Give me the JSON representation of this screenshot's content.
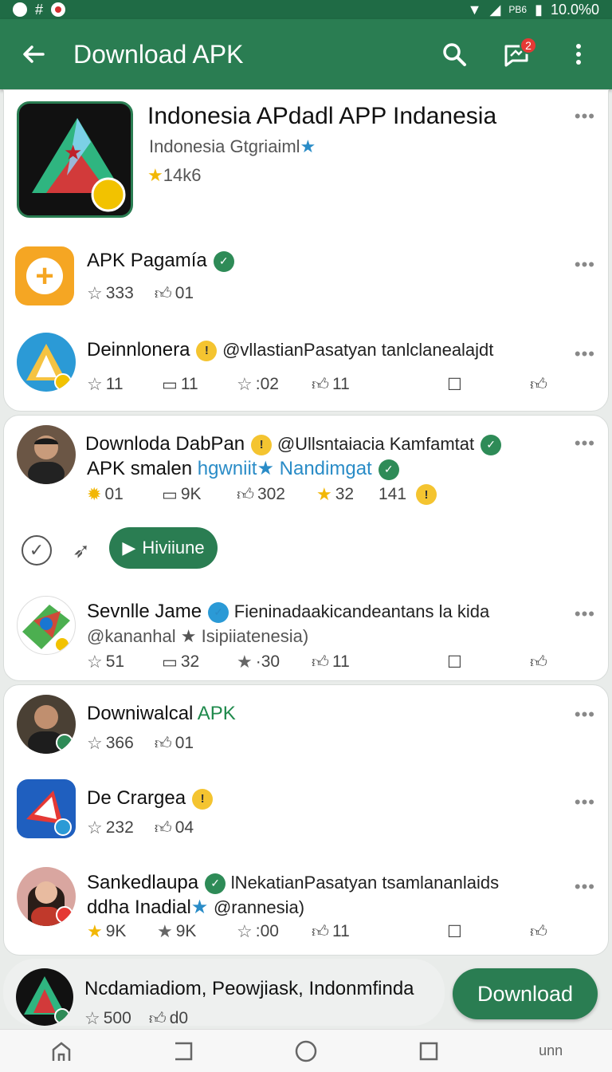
{
  "status_bar": {
    "right_text": "10.0%0",
    "signal_text": "PB6"
  },
  "app_bar": {
    "title": "Download APK",
    "notification_count": "2"
  },
  "featured": {
    "title": "Indonesia APdadl APP Indanesia",
    "developer": "Indonesia Gtgriaiml",
    "rating": "14k6"
  },
  "items_card1": [
    {
      "name": "APK Pagamía",
      "stats": [
        "333",
        "01"
      ]
    },
    {
      "name": "Deinnlonera",
      "handle": "@vllastianPasatyan tanlclanealajdt",
      "stats": [
        "11",
        "11",
        ":02",
        "11"
      ]
    }
  ],
  "items_card2": [
    {
      "name": "Downloda DabPan",
      "handle": "@Ullsntaiacia Kamfamtat",
      "line2_a": "APK smalen",
      "line2_b": "hgwniit",
      "line2_c": "Nandimgat",
      "stats": [
        "01",
        "9K",
        "302",
        "32",
        "141"
      ]
    },
    {
      "name": "Sevnlle Jame",
      "handle": "Fieninadaakicandeantans la kida",
      "line2": "@kananhal",
      "line2_b": "Isipiiatenesia)",
      "stats": [
        "51",
        "32",
        "·30",
        "11"
      ]
    }
  ],
  "action_pill": {
    "label": "Hiviiune"
  },
  "items_card3": [
    {
      "name": "Downiwalcal",
      "name_accent": "APK",
      "stats": [
        "366",
        "01"
      ]
    },
    {
      "name": "De Crargea",
      "stats": [
        "232",
        "04"
      ]
    },
    {
      "name": "Sankedlaupa",
      "handle": "lNekatianPasatyan tsamlananlaids",
      "line2": "ddha Inadial",
      "line2_b": "@rannesia)",
      "stats": [
        "9K",
        "9K",
        ":00",
        "11"
      ]
    }
  ],
  "bottom_item": {
    "name": "Ncdamiadiom, Peowjiask, Indonmfinda",
    "stats": [
      "500",
      "d0"
    ]
  },
  "download_button": {
    "label": "Download"
  },
  "nav": {
    "last_label": "unn"
  },
  "colors": {
    "primary": "#2a7d52",
    "status": "#1f6b45",
    "accent_green": "#1f8a4c",
    "accent_blue": "#2a8cc7"
  }
}
